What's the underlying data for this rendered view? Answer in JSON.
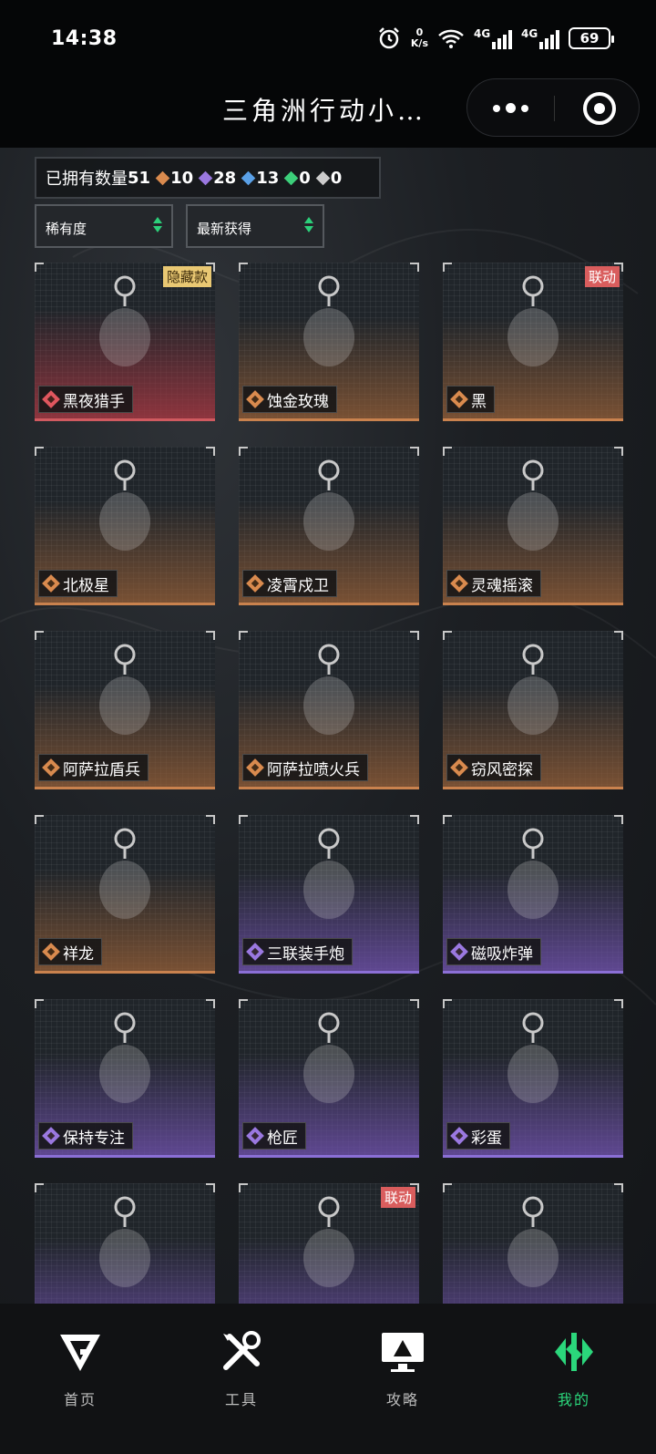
{
  "status_bar": {
    "time": "14:38",
    "net_speed_value": "0",
    "net_speed_unit": "K/s",
    "sim1": "4G",
    "sim2": "4G",
    "battery": "69"
  },
  "title_bar": {
    "title": "三角洲行动小…"
  },
  "summary": {
    "owned_label": "已拥有数量",
    "owned_total": "51",
    "counts": [
      {
        "icon": "gold-diamond-icon",
        "value": "10",
        "color": "#d98a4e"
      },
      {
        "icon": "purple-diamond-icon",
        "value": "28",
        "color": "#9a78e0"
      },
      {
        "icon": "blue-diamond-icon",
        "value": "13",
        "color": "#5aa0e6"
      },
      {
        "icon": "green-diamond-icon",
        "value": "0",
        "color": "#3ccf7a"
      },
      {
        "icon": "white-diamond-icon",
        "value": "0",
        "color": "#cccccc"
      }
    ]
  },
  "filters": {
    "rarity": "稀有度",
    "sort": "最新获得"
  },
  "items": [
    {
      "name": "黑夜猎手",
      "rarity": "red",
      "badge": "隐藏款",
      "badge_type": "hidden"
    },
    {
      "name": "蚀金玫瑰",
      "rarity": "gold",
      "badge": ""
    },
    {
      "name": "黑",
      "rarity": "gold",
      "badge": "联动",
      "badge_type": "collab"
    },
    {
      "name": "北极星",
      "rarity": "gold",
      "badge": ""
    },
    {
      "name": "凌霄戍卫",
      "rarity": "gold",
      "badge": ""
    },
    {
      "name": "灵魂摇滚",
      "rarity": "gold",
      "badge": ""
    },
    {
      "name": "阿萨拉盾兵",
      "rarity": "gold",
      "badge": ""
    },
    {
      "name": "阿萨拉喷火兵",
      "rarity": "gold",
      "badge": ""
    },
    {
      "name": "窃风密探",
      "rarity": "gold",
      "badge": ""
    },
    {
      "name": "祥龙",
      "rarity": "gold",
      "badge": ""
    },
    {
      "name": "三联装手炮",
      "rarity": "purple",
      "badge": ""
    },
    {
      "name": "磁吸炸弹",
      "rarity": "purple",
      "badge": ""
    },
    {
      "name": "保持专注",
      "rarity": "purple",
      "badge": ""
    },
    {
      "name": "枪匠",
      "rarity": "purple",
      "badge": ""
    },
    {
      "name": "彩蛋",
      "rarity": "purple",
      "badge": ""
    },
    {
      "name": "",
      "rarity": "purple",
      "badge": ""
    },
    {
      "name": "",
      "rarity": "purple",
      "badge": "联动",
      "badge_type": "collab"
    },
    {
      "name": "",
      "rarity": "purple",
      "badge": ""
    }
  ],
  "bottom_nav": [
    {
      "label": "首页",
      "icon": "home-logo-icon"
    },
    {
      "label": "工具",
      "icon": "tools-icon"
    },
    {
      "label": "攻略",
      "icon": "guide-monitor-icon"
    },
    {
      "label": "我的",
      "icon": "profile-logo-icon",
      "active": true
    }
  ]
}
